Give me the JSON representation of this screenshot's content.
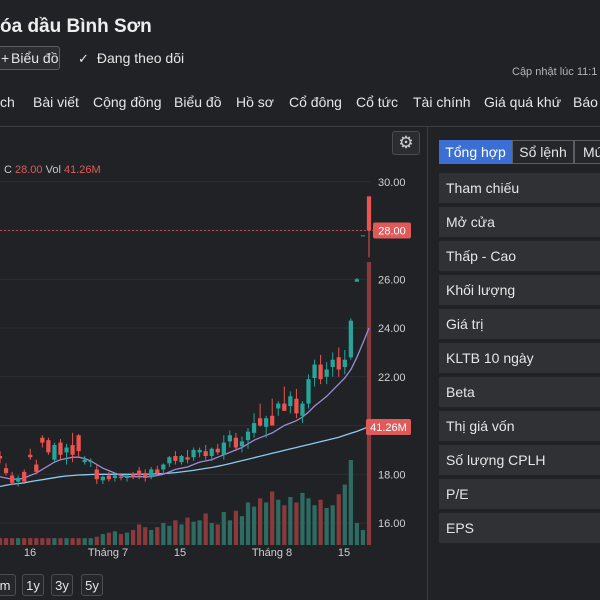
{
  "header": {
    "title": "óa dầu Bình Sơn",
    "chart_button_label": "Biểu đồ",
    "follow_label": "Đang theo dõi",
    "updated_label": "Cập nhật lúc  11:1"
  },
  "tabs": [
    "ch",
    "Bài viết",
    "Cộng đồng",
    "Biểu đồ",
    "Hồ sơ",
    "Cổ đông",
    "Cổ tức",
    "Tài chính",
    "Giá quá khứ",
    "Báo"
  ],
  "chart": {
    "ohlc_prefix": "C",
    "close_value": "28.00",
    "vol_label": "Vol",
    "vol_value": "41.26M",
    "last_price_tag": "28.00",
    "last_volume_tag": "41.26M",
    "range_buttons": [
      "m",
      "1y",
      "3y",
      "5y"
    ]
  },
  "chart_data": {
    "type": "candlestick",
    "y_axis_ticks": [
      "30.00",
      "28.00",
      "26.00",
      "24.00",
      "22.00",
      "20.00",
      "18.00",
      "16.00"
    ],
    "ylim": [
      15.1,
      30.4
    ],
    "x_tick_labels": [
      "16",
      "Tháng 7",
      "15",
      "Tháng 8",
      "15"
    ],
    "colors": {
      "up": "#26a69a",
      "down": "#ef5350",
      "ma_short": "#9b8bd6",
      "ma_long": "#8ec9f0"
    },
    "candles": [
      {
        "o": 18.75,
        "h": 18.95,
        "l": 18.45,
        "c": 18.65
      },
      {
        "o": 18.25,
        "h": 18.45,
        "l": 17.95,
        "c": 18.05
      },
      {
        "o": 17.95,
        "h": 18.1,
        "l": 17.55,
        "c": 17.65
      },
      {
        "o": 17.7,
        "h": 17.95,
        "l": 17.5,
        "c": 17.85
      },
      {
        "o": 18.1,
        "h": 18.2,
        "l": 17.6,
        "c": 17.7
      },
      {
        "o": 18.8,
        "h": 19.05,
        "l": 18.6,
        "c": 18.7
      },
      {
        "o": 18.4,
        "h": 18.6,
        "l": 18.0,
        "c": 18.1
      },
      {
        "o": 19.5,
        "h": 19.6,
        "l": 19.1,
        "c": 19.3
      },
      {
        "o": 19.4,
        "h": 19.5,
        "l": 18.8,
        "c": 18.9
      },
      {
        "o": 18.6,
        "h": 19.3,
        "l": 18.5,
        "c": 19.2
      },
      {
        "o": 19.3,
        "h": 19.45,
        "l": 18.6,
        "c": 18.8
      },
      {
        "o": 18.9,
        "h": 19.25,
        "l": 18.4,
        "c": 19.1
      },
      {
        "o": 19.2,
        "h": 19.7,
        "l": 18.5,
        "c": 18.8
      },
      {
        "o": 19.6,
        "h": 19.65,
        "l": 18.7,
        "c": 18.95
      },
      {
        "o": 18.5,
        "h": 18.75,
        "l": 18.4,
        "c": 18.6
      },
      {
        "o": 18.5,
        "h": 18.65,
        "l": 18.3,
        "c": 18.55
      },
      {
        "o": 18.2,
        "h": 18.4,
        "l": 17.6,
        "c": 17.8
      },
      {
        "o": 17.75,
        "h": 17.95,
        "l": 17.6,
        "c": 17.9
      },
      {
        "o": 17.95,
        "h": 18.1,
        "l": 17.7,
        "c": 17.8
      },
      {
        "o": 17.85,
        "h": 18.05,
        "l": 17.7,
        "c": 17.95
      },
      {
        "o": 17.9,
        "h": 18.05,
        "l": 17.75,
        "c": 17.85
      },
      {
        "o": 17.85,
        "h": 18.0,
        "l": 17.7,
        "c": 17.95
      },
      {
        "o": 18.0,
        "h": 18.1,
        "l": 17.8,
        "c": 17.9
      },
      {
        "o": 18.15,
        "h": 18.3,
        "l": 17.8,
        "c": 17.95
      },
      {
        "o": 18.05,
        "h": 18.2,
        "l": 17.7,
        "c": 17.85
      },
      {
        "o": 17.9,
        "h": 18.3,
        "l": 17.8,
        "c": 18.2
      },
      {
        "o": 18.2,
        "h": 18.35,
        "l": 17.95,
        "c": 18.05
      },
      {
        "o": 18.2,
        "h": 18.45,
        "l": 18.0,
        "c": 18.4
      },
      {
        "o": 18.45,
        "h": 18.75,
        "l": 18.3,
        "c": 18.7
      },
      {
        "o": 18.75,
        "h": 18.95,
        "l": 18.4,
        "c": 18.55
      },
      {
        "o": 18.5,
        "h": 18.8,
        "l": 18.4,
        "c": 18.75
      },
      {
        "o": 18.7,
        "h": 19.0,
        "l": 18.45,
        "c": 18.6
      },
      {
        "o": 18.7,
        "h": 19.1,
        "l": 18.55,
        "c": 19.0
      },
      {
        "o": 18.9,
        "h": 19.1,
        "l": 18.7,
        "c": 19.0
      },
      {
        "o": 18.95,
        "h": 19.2,
        "l": 18.6,
        "c": 18.75
      },
      {
        "o": 18.75,
        "h": 19.1,
        "l": 18.55,
        "c": 19.05
      },
      {
        "o": 19.05,
        "h": 19.25,
        "l": 18.8,
        "c": 18.9
      },
      {
        "o": 18.8,
        "h": 19.6,
        "l": 18.6,
        "c": 19.3
      },
      {
        "o": 19.35,
        "h": 19.8,
        "l": 19.1,
        "c": 19.6
      },
      {
        "o": 19.5,
        "h": 19.7,
        "l": 18.95,
        "c": 19.1
      },
      {
        "o": 19.15,
        "h": 19.55,
        "l": 18.9,
        "c": 19.35
      },
      {
        "o": 19.4,
        "h": 19.9,
        "l": 19.05,
        "c": 19.75
      },
      {
        "o": 19.7,
        "h": 20.5,
        "l": 19.5,
        "c": 20.1
      },
      {
        "o": 20.3,
        "h": 20.9,
        "l": 19.95,
        "c": 20.0
      },
      {
        "o": 19.95,
        "h": 20.4,
        "l": 19.5,
        "c": 20.3
      },
      {
        "o": 20.4,
        "h": 21.1,
        "l": 20.2,
        "c": 20.0
      },
      {
        "o": 20.7,
        "h": 21.0,
        "l": 20.4,
        "c": 20.9
      },
      {
        "o": 20.9,
        "h": 21.6,
        "l": 20.7,
        "c": 20.6
      },
      {
        "o": 20.8,
        "h": 21.4,
        "l": 20.5,
        "c": 21.2
      },
      {
        "o": 21.1,
        "h": 21.5,
        "l": 20.3,
        "c": 20.5
      },
      {
        "o": 20.4,
        "h": 21.0,
        "l": 20.1,
        "c": 20.9
      },
      {
        "o": 20.9,
        "h": 22.1,
        "l": 20.7,
        "c": 21.9
      },
      {
        "o": 21.95,
        "h": 22.7,
        "l": 21.6,
        "c": 22.5
      },
      {
        "o": 22.5,
        "h": 22.9,
        "l": 21.7,
        "c": 21.9
      },
      {
        "o": 22.0,
        "h": 22.6,
        "l": 21.7,
        "c": 22.3
      },
      {
        "o": 22.4,
        "h": 23.0,
        "l": 22.0,
        "c": 22.7
      },
      {
        "o": 22.8,
        "h": 23.2,
        "l": 22.0,
        "c": 22.3
      },
      {
        "o": 22.4,
        "h": 23.1,
        "l": 22.1,
        "c": 22.7
      },
      {
        "o": 22.8,
        "h": 24.4,
        "l": 22.7,
        "c": 24.3
      },
      {
        "o": 25.9,
        "h": 26.05,
        "l": 25.9,
        "c": 26.0
      },
      {
        "o": 27.8,
        "h": 27.8,
        "l": 27.8,
        "c": 27.8
      },
      {
        "o": 29.4,
        "h": 29.4,
        "l": 26.9,
        "c": 28.0
      }
    ],
    "volume": [
      1,
      1,
      1,
      1,
      1,
      1,
      1,
      1,
      1,
      1,
      1,
      1,
      1,
      1,
      1,
      1,
      1.2,
      1.6,
      1.8,
      2.0,
      1.6,
      1.8,
      2.2,
      3.0,
      2.6,
      2.2,
      2.6,
      3.2,
      2.8,
      3.6,
      3.0,
      4.0,
      3.4,
      3.6,
      4.6,
      3.2,
      3.0,
      4.8,
      3.6,
      5.0,
      4.2,
      6.2,
      5.6,
      6.8,
      6.2,
      7.8,
      6.6,
      5.8,
      7.0,
      6.2,
      7.6,
      6.8,
      5.8,
      6.6,
      5.4,
      5.8,
      7.4,
      8.8,
      12.4,
      3.2,
      2.2,
      41.26
    ],
    "ma_short": [
      17.9,
      17.85,
      17.8,
      17.8,
      17.85,
      17.95,
      18.05,
      18.2,
      18.35,
      18.5,
      18.6,
      18.65,
      18.7,
      18.7,
      18.65,
      18.55,
      18.4,
      18.25,
      18.15,
      18.05,
      17.95,
      17.9,
      17.9,
      17.9,
      17.9,
      17.9,
      17.95,
      18.0,
      18.1,
      18.2,
      18.25,
      18.3,
      18.4,
      18.5,
      18.55,
      18.6,
      18.7,
      18.8,
      18.9,
      19.0,
      19.1,
      19.25,
      19.4,
      19.5,
      19.6,
      19.7,
      19.85,
      20.0,
      20.1,
      20.2,
      20.35,
      20.55,
      20.8,
      21.0,
      21.2,
      21.45,
      21.7,
      21.95,
      22.3,
      22.8,
      23.4,
      24.0
    ],
    "ma_long": [
      17.5,
      17.55,
      17.6,
      17.62,
      17.65,
      17.7,
      17.74,
      17.78,
      17.82,
      17.86,
      17.9,
      17.93,
      17.95,
      17.97,
      17.98,
      17.99,
      18.0,
      18.0,
      18.0,
      18.0,
      18.0,
      18.0,
      18.0,
      18.0,
      18.0,
      18.01,
      18.02,
      18.03,
      18.05,
      18.07,
      18.1,
      18.13,
      18.16,
      18.2,
      18.24,
      18.28,
      18.33,
      18.38,
      18.44,
      18.5,
      18.56,
      18.62,
      18.68,
      18.74,
      18.8,
      18.86,
      18.92,
      18.98,
      19.04,
      19.1,
      19.16,
      19.22,
      19.28,
      19.34,
      19.4,
      19.46,
      19.52,
      19.6,
      19.68,
      19.76,
      19.86,
      19.96
    ]
  },
  "right_panel": {
    "tabs": [
      "Tổng hợp",
      "Sổ lệnh",
      "Mú"
    ],
    "rows": [
      "Tham chiếu",
      "Mở cửa",
      "Thấp - Cao",
      "Khối lượng",
      "Giá trị",
      "KLTB 10 ngày",
      "Beta",
      "Thị giá vốn",
      "Số lượng CPLH",
      "P/E",
      "EPS"
    ]
  }
}
